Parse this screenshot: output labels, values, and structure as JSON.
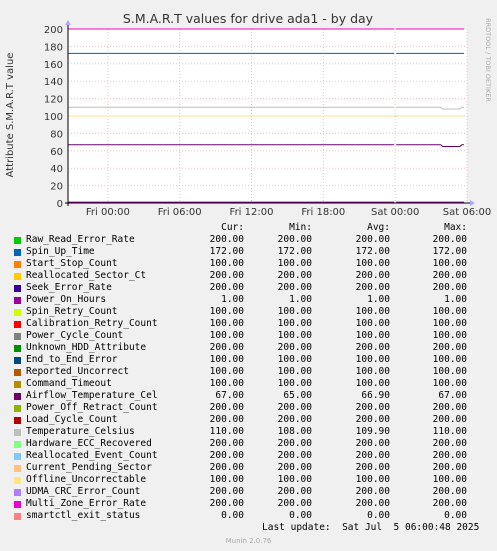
{
  "chart_data": {
    "type": "line",
    "title": "S.M.A.R.T values for drive ada1 - by day",
    "ylabel": "Attribute S.M.A.R.T value",
    "ylim": [
      0,
      200
    ],
    "y_ticks": [
      "0",
      "20",
      "40",
      "60",
      "80",
      "100",
      "120",
      "140",
      "160",
      "180",
      "200"
    ],
    "x_range": [
      "Fri 2025-07-04 00:00",
      "Sat 2025-07-05 06:00"
    ],
    "x_ticks": [
      "Fri 00:00",
      "Fri 06:00",
      "Fri 12:00",
      "Fri 18:00",
      "Sat 00:00",
      "Sat 06:00"
    ],
    "watermark": "RRDTOOL / TOBI OETIKER",
    "grid": true,
    "series": [
      {
        "name": "Raw_Read_Error_Rate",
        "color": "#00cc00",
        "cur": "200.00",
        "min": "200.00",
        "avg": "200.00",
        "max": "200.00"
      },
      {
        "name": "Spin_Up_Time",
        "color": "#0066b3",
        "cur": "172.00",
        "min": "172.00",
        "avg": "172.00",
        "max": "172.00"
      },
      {
        "name": "Start_Stop_Count",
        "color": "#ff8000",
        "cur": "100.00",
        "min": "100.00",
        "avg": "100.00",
        "max": "100.00"
      },
      {
        "name": "Reallocated_Sector_Ct",
        "color": "#ffcc00",
        "cur": "200.00",
        "min": "200.00",
        "avg": "200.00",
        "max": "200.00"
      },
      {
        "name": "Seek_Error_Rate",
        "color": "#330099",
        "cur": "200.00",
        "min": "200.00",
        "avg": "200.00",
        "max": "200.00"
      },
      {
        "name": "Power_On_Hours",
        "color": "#990099",
        "cur": "1.00",
        "min": "1.00",
        "avg": "1.00",
        "max": "1.00"
      },
      {
        "name": "Spin_Retry_Count",
        "color": "#ccff00",
        "cur": "100.00",
        "min": "100.00",
        "avg": "100.00",
        "max": "100.00"
      },
      {
        "name": "Calibration_Retry_Count",
        "color": "#ff0000",
        "cur": "100.00",
        "min": "100.00",
        "avg": "100.00",
        "max": "100.00"
      },
      {
        "name": "Power_Cycle_Count",
        "color": "#808080",
        "cur": "100.00",
        "min": "100.00",
        "avg": "100.00",
        "max": "100.00"
      },
      {
        "name": "Unknown_HDD_Attribute",
        "color": "#008f00",
        "cur": "200.00",
        "min": "200.00",
        "avg": "200.00",
        "max": "200.00"
      },
      {
        "name": "End_to_End_Error",
        "color": "#00487d",
        "cur": "100.00",
        "min": "100.00",
        "avg": "100.00",
        "max": "100.00"
      },
      {
        "name": "Reported_Uncorrect",
        "color": "#b35a00",
        "cur": "100.00",
        "min": "100.00",
        "avg": "100.00",
        "max": "100.00"
      },
      {
        "name": "Command_Timeout",
        "color": "#b38f00",
        "cur": "100.00",
        "min": "100.00",
        "avg": "100.00",
        "max": "100.00"
      },
      {
        "name": "Airflow_Temperature_Cel",
        "color": "#6b006b",
        "cur": "67.00",
        "min": "65.00",
        "avg": "66.90",
        "max": "67.00"
      },
      {
        "name": "Power_Off_Retract_Count",
        "color": "#8fb300",
        "cur": "200.00",
        "min": "200.00",
        "avg": "200.00",
        "max": "200.00"
      },
      {
        "name": "Load_Cycle_Count",
        "color": "#b30000",
        "cur": "200.00",
        "min": "200.00",
        "avg": "200.00",
        "max": "200.00"
      },
      {
        "name": "Temperature_Celsius",
        "color": "#bebebe",
        "cur": "110.00",
        "min": "108.00",
        "avg": "109.90",
        "max": "110.00"
      },
      {
        "name": "Hardware_ECC_Recovered",
        "color": "#80ff80",
        "cur": "200.00",
        "min": "200.00",
        "avg": "200.00",
        "max": "200.00"
      },
      {
        "name": "Reallocated_Event_Count",
        "color": "#80c9ff",
        "cur": "200.00",
        "min": "200.00",
        "avg": "200.00",
        "max": "200.00"
      },
      {
        "name": "Current_Pending_Sector",
        "color": "#ffc080",
        "cur": "200.00",
        "min": "200.00",
        "avg": "200.00",
        "max": "200.00"
      },
      {
        "name": "Offline_Uncorrectable",
        "color": "#ffe680",
        "cur": "100.00",
        "min": "100.00",
        "avg": "100.00",
        "max": "100.00"
      },
      {
        "name": "UDMA_CRC_Error_Count",
        "color": "#aa80ff",
        "cur": "200.00",
        "min": "200.00",
        "avg": "200.00",
        "max": "200.00"
      },
      {
        "name": "Multi_Zone_Error_Rate",
        "color": "#ee00cc",
        "cur": "200.00",
        "min": "200.00",
        "avg": "200.00",
        "max": "200.00"
      },
      {
        "name": "smartctl_exit_status",
        "color": "#ff8080",
        "cur": "0.00",
        "min": "0.00",
        "avg": "0.00",
        "max": "0.00"
      }
    ]
  },
  "legend": {
    "cur_label": "Cur:",
    "min_label": "Min:",
    "avg_label": "Avg:",
    "max_label": "Max:"
  },
  "last_update": "Last update:  Sat Jul  5 06:00:48 2025",
  "footer": "Munin 2.0.76"
}
